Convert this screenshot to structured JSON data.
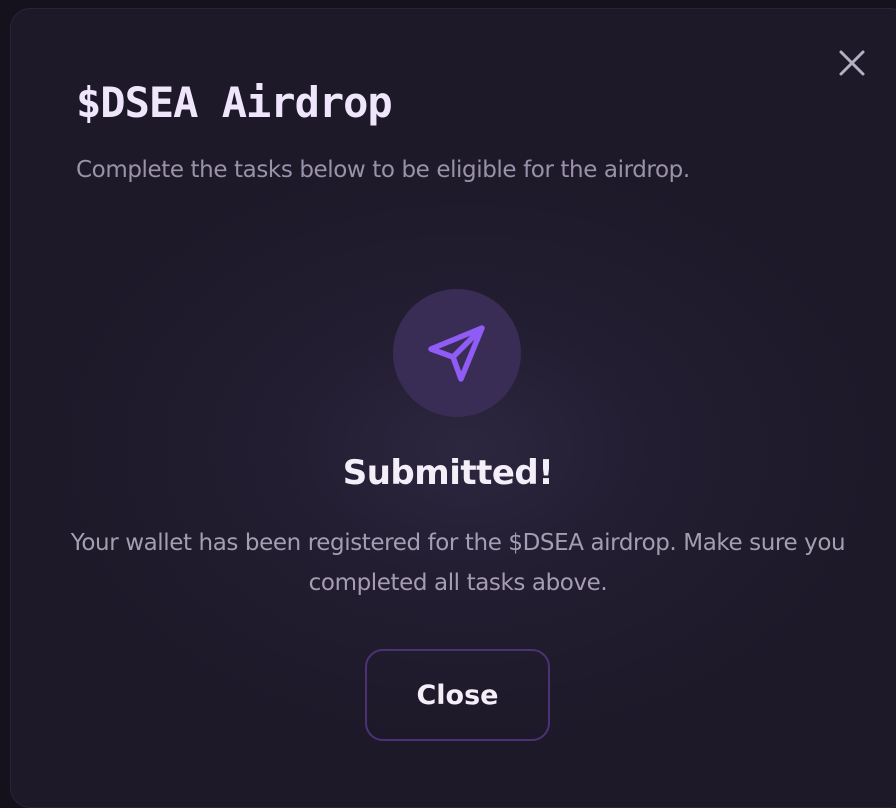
{
  "modal": {
    "title": "$DSEA Airdrop",
    "subtitle": "Complete the tasks below to be eligible for the airdrop.",
    "close_icon": "close-icon",
    "status": {
      "icon": "send-icon",
      "heading": "Submitted!",
      "message": "Your wallet has been registered for the $DSEA airdrop. Make sure you completed all tasks above."
    },
    "close_button_label": "Close"
  },
  "colors": {
    "accent": "#8b5cf6",
    "icon_circle_bg": "#3a2d55",
    "button_border": "#4b3275",
    "modal_bg": "#221d30"
  }
}
